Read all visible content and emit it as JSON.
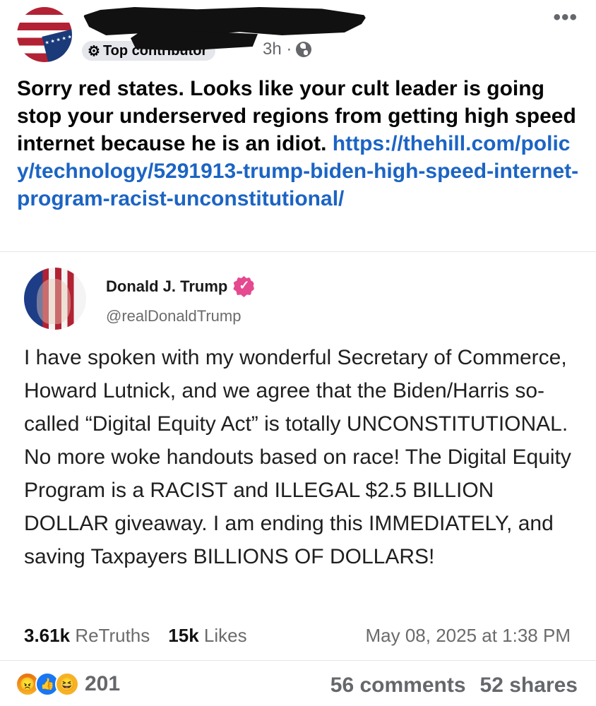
{
  "post": {
    "badge": "Top contributor",
    "time": "3h ·",
    "more": "•••",
    "text": "Sorry red states. Looks like your cult leader is going stop your underserved regions from getting high speed internet because he is an idiot.",
    "link": "https://thehill.com/policy/technology/5291913-trump-biden-high-speed-internet-program-racist-unconstitutional/"
  },
  "truth": {
    "name": "Donald J. Trump",
    "handle": "@realDonaldTrump",
    "body": "I have spoken with my wonderful Secretary of Commerce, Howard Lutnick, and we agree that the Biden/Harris so-called “Digital Equity Act” is totally UNCONSTITUTIONAL. No more woke handouts based on race! The Digital Equity Program is a RACIST and ILLEGAL $2.5 BILLION DOLLAR giveaway. I am ending this IMMEDIATELY, and saving Taxpayers BILLIONS OF DOLLARS!",
    "retruths_count": "3.61k",
    "retruths_label": "ReTruths",
    "likes_count": "15k",
    "likes_label": "Likes",
    "date": "May 08, 2025 at 1:38 PM"
  },
  "footer": {
    "reaction_count": "201",
    "comments": "56 comments",
    "shares": "52 shares",
    "reactions": [
      "angry-icon",
      "like-icon",
      "haha-icon"
    ]
  },
  "colors": {
    "link": "#1c64c4",
    "verified": "#e5498f",
    "like": "#1877f2"
  }
}
